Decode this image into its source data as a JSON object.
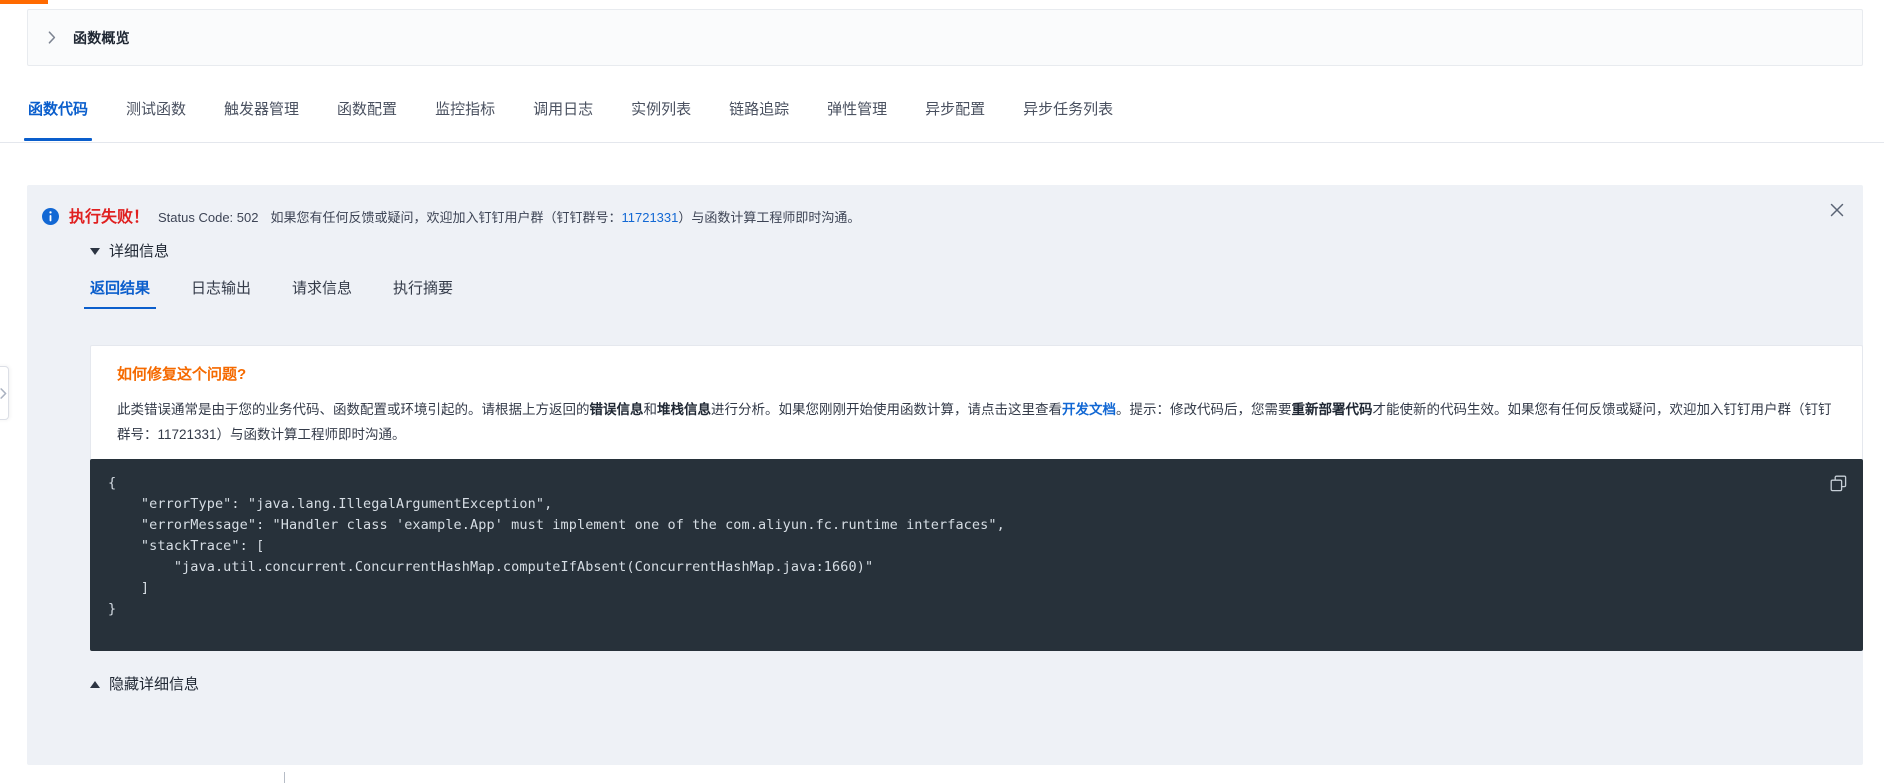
{
  "theme": {
    "accent_blue": "#0a5ecc",
    "link_blue": "#1268d4",
    "error_red": "#e02020",
    "warn_orange": "#f56a00",
    "progress_orange": "#ff6a00",
    "alert_bg": "#eef1f6",
    "code_bg": "#27313a"
  },
  "overview": {
    "title": "函数概览",
    "caret_icon": "chevron-right-icon"
  },
  "tabs": [
    {
      "label": "函数代码",
      "active": true
    },
    {
      "label": "测试函数",
      "active": false
    },
    {
      "label": "触发器管理",
      "active": false
    },
    {
      "label": "函数配置",
      "active": false
    },
    {
      "label": "监控指标",
      "active": false
    },
    {
      "label": "调用日志",
      "active": false
    },
    {
      "label": "实例列表",
      "active": false
    },
    {
      "label": "链路追踪",
      "active": false
    },
    {
      "label": "弹性管理",
      "active": false
    },
    {
      "label": "异步配置",
      "active": false
    },
    {
      "label": "异步任务列表",
      "active": false
    }
  ],
  "alert": {
    "icon": "info-circle-icon",
    "close_icon": "close-icon",
    "title": "执行失败！",
    "status_code_text": "Status Code: 502",
    "message_prefix": "如果您有任何反馈或疑问，欢迎加入钉钉用户群（钉钉群号：",
    "dingtalk_group_id": "11721331",
    "message_suffix": "）与函数计算工程师即时沟通。"
  },
  "details": {
    "toggle_label": "详细信息",
    "toggle_caret_icon": "caret-down-icon",
    "subtabs": [
      {
        "label": "返回结果",
        "active": true
      },
      {
        "label": "日志输出",
        "active": false
      },
      {
        "label": "请求信息",
        "active": false
      },
      {
        "label": "执行摘要",
        "active": false
      }
    ]
  },
  "fix_card": {
    "title": "如何修复这个问题?",
    "paragraph_1": "此类错误通常是由于您的业务代码、函数配置或环境引起的。请根据上方返回的",
    "bold_1": "错误信息",
    "paragraph_2": "和",
    "bold_2": "堆栈信息",
    "paragraph_3": "进行分析。如果您刚刚开始使用函数计算，请点击这里查看",
    "link_text": "开发文档",
    "paragraph_4": "。提示：修改代码后，您需要",
    "bold_3": "重新部署代码",
    "paragraph_5": "才能使新的代码生效。如果您有任何反馈或疑问，欢迎加入钉钉用户群（钉钉群号：11721331）与函数计算工程师即时沟通。"
  },
  "code_block": {
    "copy_icon": "copy-icon",
    "content": "{\n    \"errorType\": \"java.lang.IllegalArgumentException\",\n    \"errorMessage\": \"Handler class 'example.App' must implement one of the com.aliyun.fc.runtime interfaces\",\n    \"stackTrace\": [\n        \"java.util.concurrent.ConcurrentHashMap.computeIfAbsent(ConcurrentHashMap.java:1660)\"\n    ]\n}"
  },
  "hide_details": {
    "label": "隐藏详细信息",
    "caret_icon": "caret-up-icon"
  },
  "sidebar_handle": {
    "icon": "chevron-right-icon"
  }
}
